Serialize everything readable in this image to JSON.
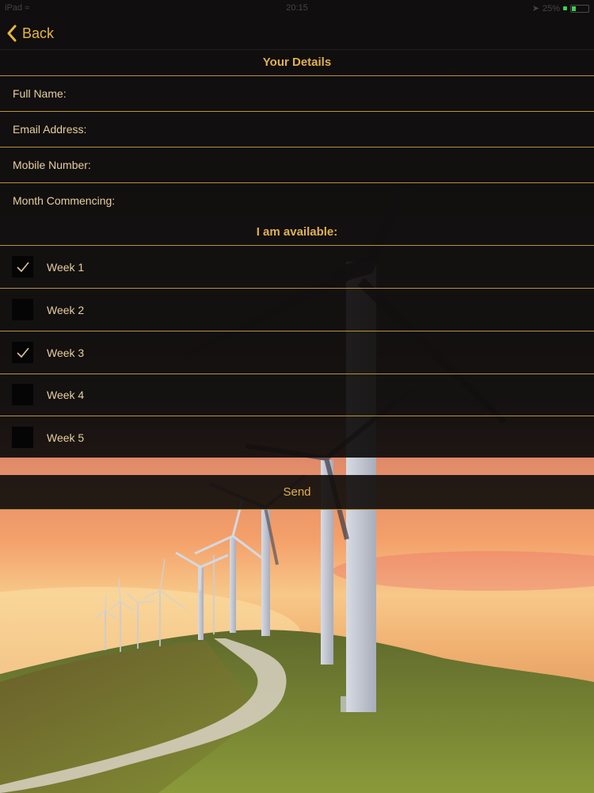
{
  "status_bar": {
    "carrier": "iPad",
    "time": "20:15",
    "battery": "25%"
  },
  "nav": {
    "back_label": "Back"
  },
  "details": {
    "title": "Your Details",
    "fields": [
      {
        "label": "Full Name:",
        "value": ""
      },
      {
        "label": "Email Address:",
        "value": ""
      },
      {
        "label": "Mobile Number:",
        "value": ""
      },
      {
        "label": "Month Commencing:",
        "value": ""
      }
    ]
  },
  "availability": {
    "title": "I am available:",
    "weeks": [
      {
        "label": "Week 1",
        "checked": true
      },
      {
        "label": "Week 2",
        "checked": false
      },
      {
        "label": "Week 3",
        "checked": true
      },
      {
        "label": "Week 4",
        "checked": false
      },
      {
        "label": "Week 5",
        "checked": false
      }
    ]
  },
  "send_label": "Send",
  "colors": {
    "accent": "#e0b14f",
    "divider": "#b9923c",
    "panel": "#141210"
  },
  "icons": {
    "back": "chevron-left-icon",
    "check": "checkmark-icon",
    "wifi": "wifi-icon",
    "battery": "battery-icon"
  }
}
